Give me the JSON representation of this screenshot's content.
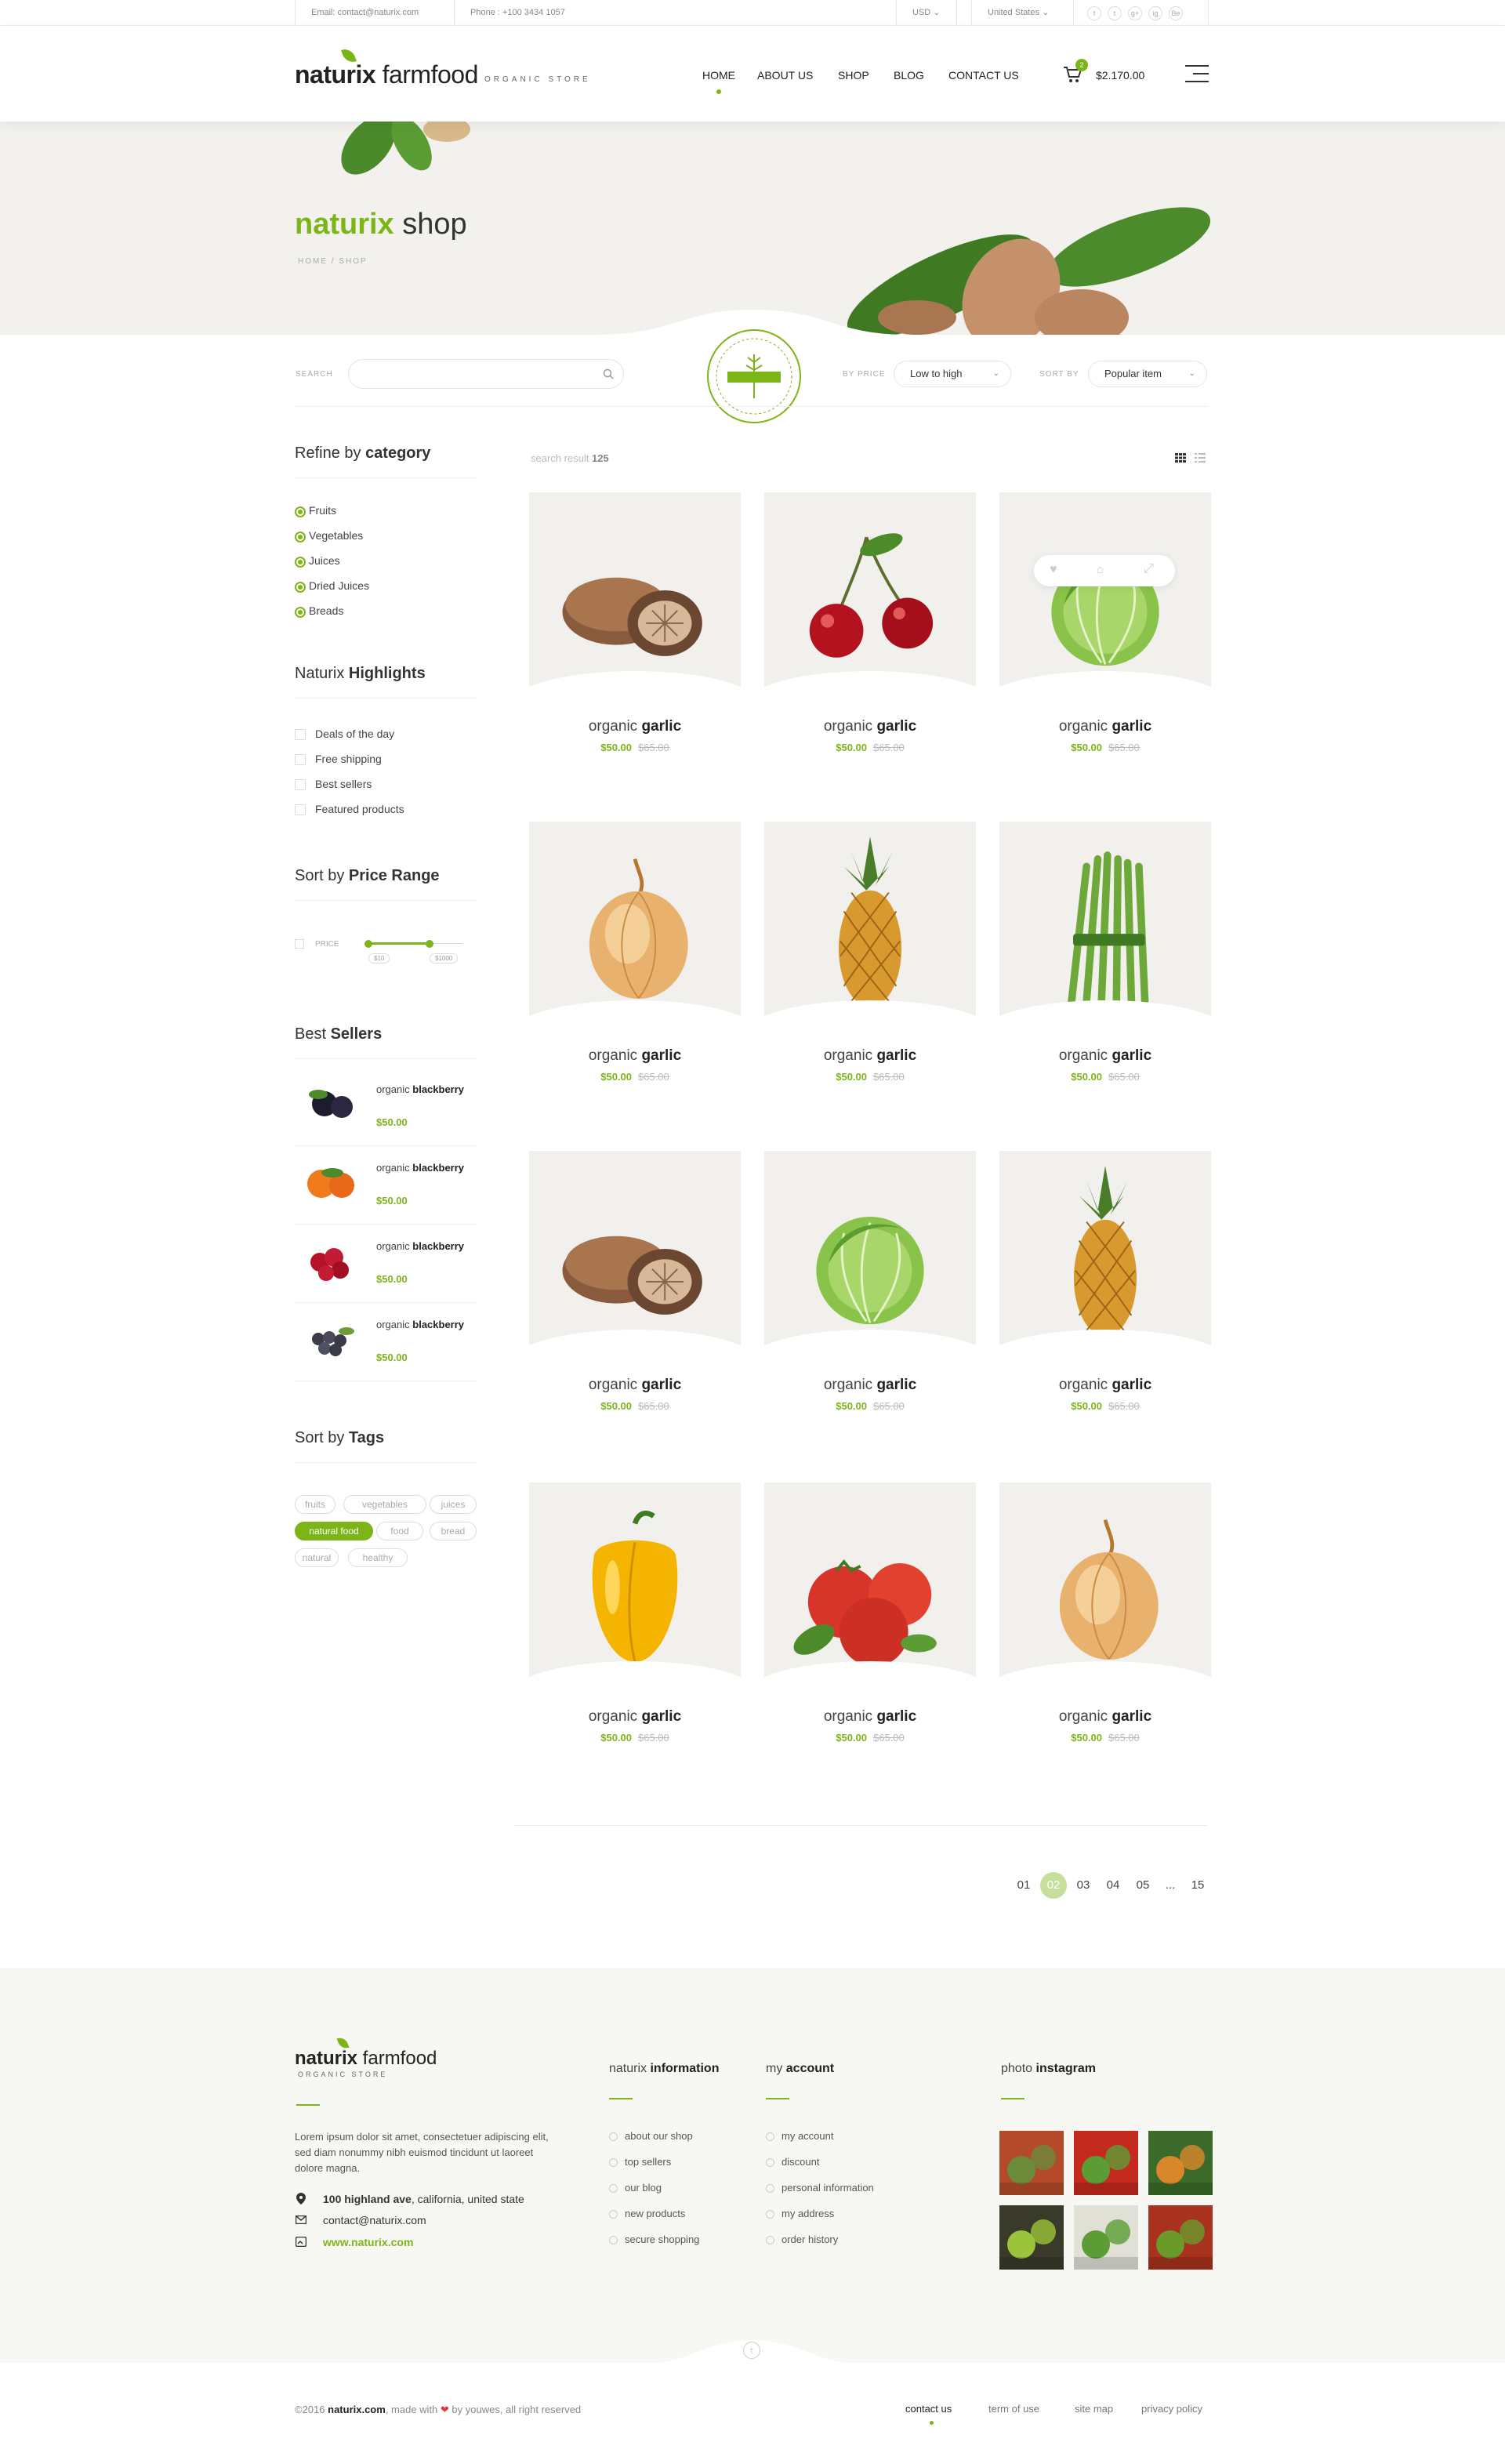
{
  "topbar": {
    "email": "Email: contact@naturix.com",
    "phone": "Phone : +100 3434 1057",
    "currency": "USD",
    "country": "United States",
    "social": [
      "f",
      "t",
      "g+",
      "ig",
      "Be"
    ]
  },
  "header": {
    "brand_bold": "naturix",
    "brand_light": " farmfood",
    "tagline": "ORGANIC STORE",
    "nav": [
      "HOME",
      "ABOUT US",
      "SHOP",
      "BLOG",
      "CONTACT US"
    ],
    "active_nav": "HOME",
    "cart_count": "2",
    "cart_total": "$2.170.00"
  },
  "banner": {
    "title_bold": "naturix",
    "title_light": " shop",
    "breadcrumb": "HOME / SHOP"
  },
  "filters": {
    "search_label": "SEARCH",
    "search_placeholder": "",
    "stamp_text": "ORGANIC FRESH FOOD",
    "price_label": "BY PRICE",
    "price_value": "Low to high",
    "sort_label": "SORT BY",
    "sort_value": "Popular item"
  },
  "results": {
    "label": "search result",
    "count": "125"
  },
  "sidebar": {
    "category_title_a": "Refine by",
    "category_title_b": "category",
    "categories": [
      "Fruits",
      "Vegetables",
      "Juices",
      "Dried Juices",
      "Breads"
    ],
    "highlights_title_a": "Naturix",
    "highlights_title_b": "Highlights",
    "highlights": [
      "Deals of the day",
      "Free shipping",
      "Best sellers",
      "Featured products"
    ],
    "price_title_a": "Sort by",
    "price_title_b": "Price Range",
    "price_label": "PRICE",
    "price_min": "$10",
    "price_max": "$1000",
    "price_range_fraction": [
      0.0,
      0.65
    ],
    "bestsellers_title_a": "Best",
    "bestsellers_title_b": "Sellers",
    "bestsellers": [
      {
        "name_a": "organic",
        "name_b": "blackberry",
        "price": "$50.00",
        "image": "blackberry"
      },
      {
        "name_a": "organic",
        "name_b": "blackberry",
        "price": "$50.00",
        "image": "persimmon"
      },
      {
        "name_a": "organic",
        "name_b": "blackberry",
        "price": "$50.00",
        "image": "cranberry"
      },
      {
        "name_a": "organic",
        "name_b": "blackberry",
        "price": "$50.00",
        "image": "grapes"
      }
    ],
    "tags_title_a": "Sort by",
    "tags_title_b": "Tags",
    "tags": [
      "fruits",
      "vegetables",
      "juices",
      "natural food",
      "food",
      "bread",
      "natural",
      "healthy"
    ],
    "active_tag": "natural food"
  },
  "products": [
    {
      "name_a": "organic",
      "name_b": "garlic",
      "price": "$50.00",
      "old": "$65.00",
      "image": "mushroom"
    },
    {
      "name_a": "organic",
      "name_b": "garlic",
      "price": "$50.00",
      "old": "$65.00",
      "image": "cherry"
    },
    {
      "name_a": "organic",
      "name_b": "garlic",
      "price": "$50.00",
      "old": "$65.00",
      "image": "cabbage"
    },
    {
      "name_a": "organic",
      "name_b": "garlic",
      "price": "$50.00",
      "old": "$65.00",
      "image": "onion"
    },
    {
      "name_a": "organic",
      "name_b": "garlic",
      "price": "$50.00",
      "old": "$65.00",
      "image": "pineapple"
    },
    {
      "name_a": "organic",
      "name_b": "garlic",
      "price": "$50.00",
      "old": "$65.00",
      "image": "asparagus"
    },
    {
      "name_a": "organic",
      "name_b": "garlic",
      "price": "$50.00",
      "old": "$65.00",
      "image": "mushroom"
    },
    {
      "name_a": "organic",
      "name_b": "garlic",
      "price": "$50.00",
      "old": "$65.00",
      "image": "cabbage"
    },
    {
      "name_a": "organic",
      "name_b": "garlic",
      "price": "$50.00",
      "old": "$65.00",
      "image": "pineapple"
    },
    {
      "name_a": "organic",
      "name_b": "garlic",
      "price": "$50.00",
      "old": "$65.00",
      "image": "pepper"
    },
    {
      "name_a": "organic",
      "name_b": "garlic",
      "price": "$50.00",
      "old": "$65.00",
      "image": "tomato"
    },
    {
      "name_a": "organic",
      "name_b": "garlic",
      "price": "$50.00",
      "old": "$65.00",
      "image": "onion"
    }
  ],
  "pagination": [
    "01",
    "02",
    "03",
    "04",
    "05",
    "...",
    "15"
  ],
  "active_page": "02",
  "footer": {
    "brand_bold": "naturix",
    "brand_light": " farmfood",
    "tagline": "ORGANIC STORE",
    "about": "Lorem ipsum dolor sit amet, consectetuer adipiscing elit, sed diam nonummy nibh euismod tincidunt ut laoreet dolore magna.",
    "address_bold": "100 highland ave",
    "address_rest": ", california, united state",
    "email": "contact@naturix.com",
    "website": "www.naturix.com",
    "info_title_a": "naturix",
    "info_title_b": "information",
    "info_links": [
      "about our shop",
      "top sellers",
      "our blog",
      "new products",
      "secure shopping"
    ],
    "account_title_a": "my",
    "account_title_b": "account",
    "account_links": [
      "my account",
      "discount",
      "personal information",
      "my address",
      "order history"
    ],
    "insta_title_a": "photo",
    "insta_title_b": "instagram",
    "copyright_a": "©2016 ",
    "copyright_b": "naturix.com",
    "copyright_c": ", made with ",
    "copyright_d": " by youwes, all right reserved",
    "bottom_links": [
      "contact us",
      "term of use",
      "site map",
      "privacy policy"
    ]
  },
  "colors": {
    "accent": "#7cb518",
    "banner_bg": "#f2f1ed",
    "card_bg": "#f1f0ec",
    "footer_bg": "#f7f7f3"
  }
}
